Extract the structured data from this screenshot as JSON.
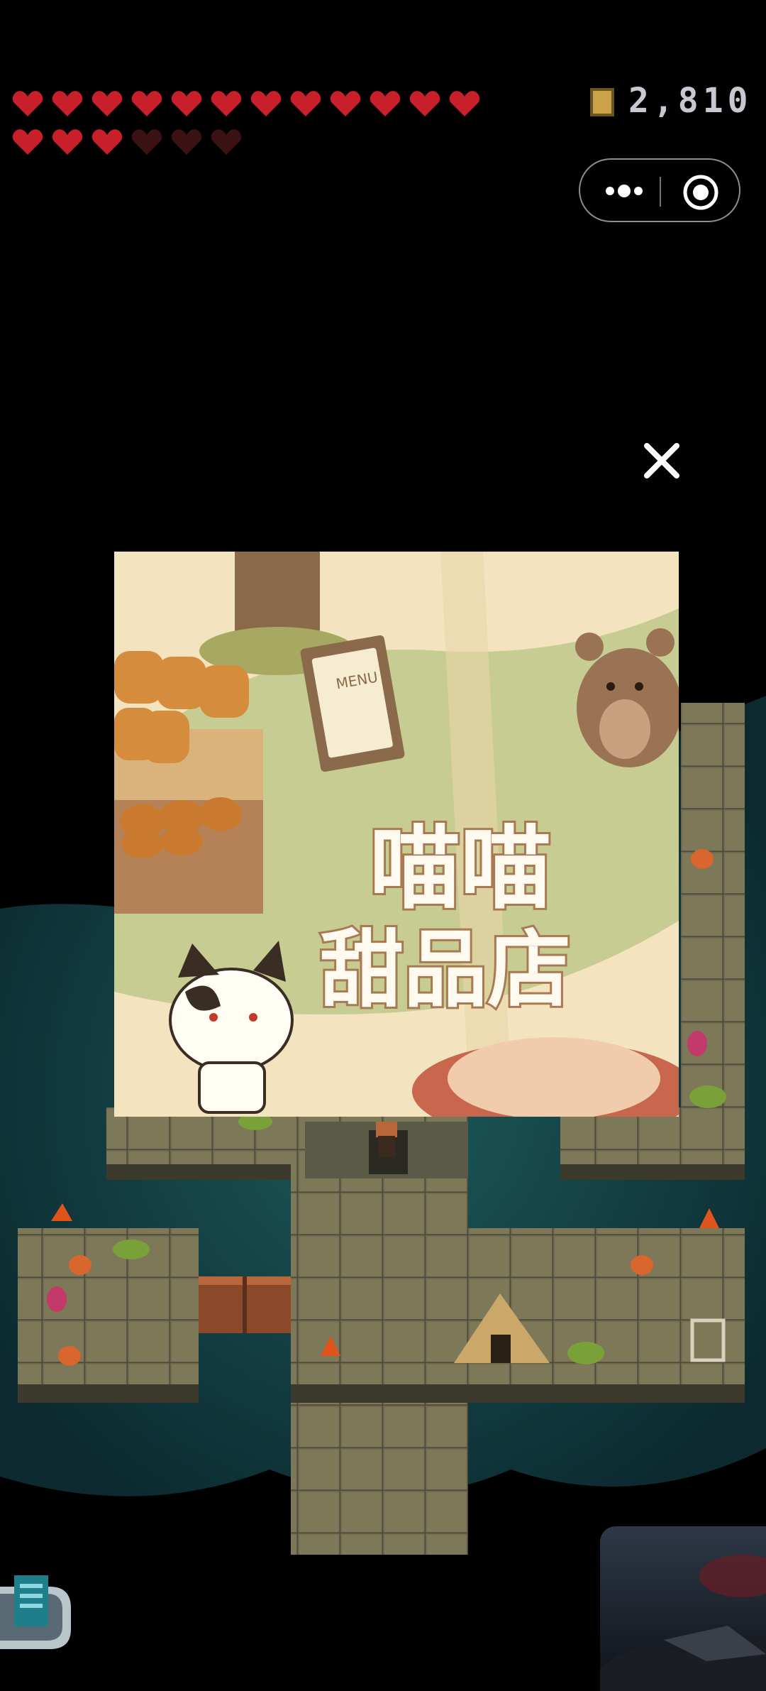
{
  "hud": {
    "hearts_row1": [
      "full",
      "full",
      "full",
      "full",
      "full",
      "full",
      "full",
      "full",
      "full",
      "full",
      "full",
      "full"
    ],
    "hearts_row2": [
      "full",
      "full",
      "full",
      "empty",
      "empty",
      "empty"
    ],
    "coin_icon": "coin-icon",
    "coin_count": "2,810",
    "colors": {
      "heart_full": "#c8202a",
      "heart_empty": "#3a1214"
    }
  },
  "capsule": {
    "more_icon": "more-dots-icon",
    "close_icon": "target-circle-icon"
  },
  "popup": {
    "close_icon": "close-icon",
    "ad_title_line1": "喵喵",
    "ad_title_line2": "甜品店",
    "menu_sign": "MENU"
  },
  "bottom": {
    "menu_icon": "list-icon",
    "thumbnail": "preview-image"
  }
}
